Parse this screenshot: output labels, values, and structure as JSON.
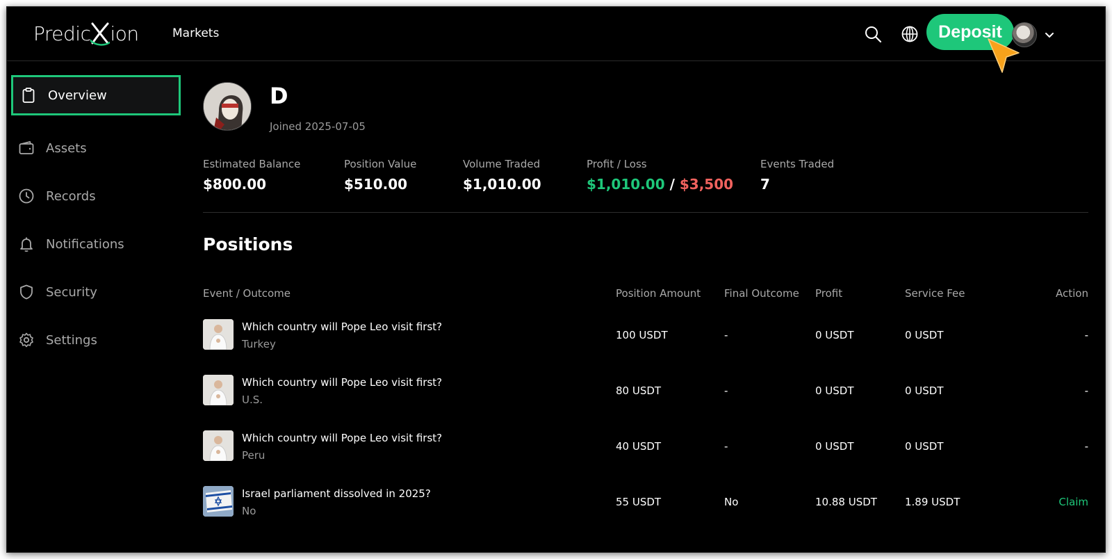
{
  "header": {
    "logo_text_left": "Predic",
    "logo_text_right": "ion",
    "nav_markets": "Markets",
    "deposit_label": "Deposit",
    "icons": [
      "search-icon",
      "globe-icon",
      "avatar",
      "chevron-down-icon"
    ]
  },
  "sidebar": {
    "items": [
      {
        "label": "Overview",
        "icon": "clipboard-icon",
        "active": true
      },
      {
        "label": "Assets",
        "icon": "wallet-icon",
        "active": false
      },
      {
        "label": "Records",
        "icon": "clock-icon",
        "active": false
      },
      {
        "label": "Notifications",
        "icon": "bell-icon",
        "active": false
      },
      {
        "label": "Security",
        "icon": "shield-icon",
        "active": false
      },
      {
        "label": "Settings",
        "icon": "gear-icon",
        "active": false
      }
    ]
  },
  "profile": {
    "name": "D",
    "joined": "Joined 2025-07-05"
  },
  "stats": {
    "estimated_balance": {
      "label": "Estimated Balance",
      "value": "$800.00"
    },
    "position_value": {
      "label": "Position Value",
      "value": "$510.00"
    },
    "volume_traded": {
      "label": "Volume Traded",
      "value": "$1,010.00"
    },
    "profit_loss": {
      "label": "Profit / Loss",
      "profit": "$1,010.00",
      "separator": "/",
      "loss": "$3,500"
    },
    "events_traded": {
      "label": "Events Traded",
      "value": "7"
    }
  },
  "positions": {
    "title": "Positions",
    "columns": {
      "event": "Event / Outcome",
      "amount": "Position Amount",
      "final_outcome": "Final Outcome",
      "profit": "Profit",
      "service_fee": "Service Fee",
      "action": "Action"
    },
    "rows": [
      {
        "question": "Which country will Pope Leo visit first?",
        "outcome": "Turkey",
        "amount": "100 USDT",
        "final_outcome": "-",
        "profit": "0 USDT",
        "service_fee": "0 USDT",
        "action": "-"
      },
      {
        "question": "Which country will Pope Leo visit first?",
        "outcome": "U.S.",
        "amount": "80 USDT",
        "final_outcome": "-",
        "profit": "0 USDT",
        "service_fee": "0 USDT",
        "action": "-"
      },
      {
        "question": "Which country will Pope Leo visit first?",
        "outcome": "Peru",
        "amount": "40 USDT",
        "final_outcome": "-",
        "profit": "0 USDT",
        "service_fee": "0 USDT",
        "action": "-"
      },
      {
        "question": "Israel parliament dissolved in 2025?",
        "outcome": "No",
        "amount": "55 USDT",
        "final_outcome": "No",
        "profit": "10.88 USDT",
        "service_fee": "1.89 USDT",
        "action": "Claim"
      }
    ]
  },
  "colors": {
    "accent_green": "#1ec77a",
    "loss_red": "#f0625e",
    "background": "#000000",
    "muted_text": "#a9a9a9"
  }
}
